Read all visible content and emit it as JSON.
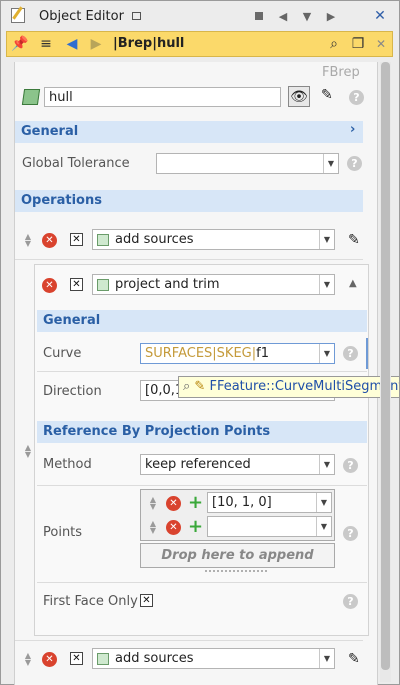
{
  "window": {
    "title": "Object Editor",
    "controls": [
      "minimize-icon",
      "left-icon",
      "down-icon",
      "right-icon",
      "close-icon"
    ]
  },
  "toolbar": {
    "path": "|Brep|hull",
    "icons": [
      "pin-icon",
      "list-icon",
      "back-icon",
      "forward-icon",
      "search-icon",
      "copy-icon",
      "close-icon"
    ]
  },
  "header": {
    "type_label": "FBrep",
    "name_value": "hull"
  },
  "general": {
    "title": "General",
    "global_tolerance_label": "Global Tolerance",
    "global_tolerance_value": ""
  },
  "operations": {
    "title": "Operations",
    "op1_label": "add sources",
    "op2_label": "project and trim",
    "op2_general_title": "General",
    "curve_label": "Curve",
    "curve_prefix": "SURFACES|SKEG|",
    "curve_value": "f1",
    "direction_label": "Direction",
    "direction_value": "[0,0,1]",
    "tooltip_text": "FFeature::CurveMultiSegment",
    "refproj_title": "Reference By Projection Points",
    "method_label": "Method",
    "method_value": "keep referenced",
    "points_label": "Points",
    "point1_value": "[10, 1, 0]",
    "point2_value": "",
    "drop_hint": "Drop here to append",
    "first_face_only_label": "First Face Only",
    "first_face_only_checked": true,
    "op3_label": "add sources"
  },
  "colors": {
    "toolbar_bg": "#fbd96a",
    "section_bg": "#d7e6f7",
    "section_text": "#2a5fa5",
    "delete_red": "#d9432e",
    "plus_green": "#3aa83a",
    "tooltip_bg": "#ffffd8"
  }
}
